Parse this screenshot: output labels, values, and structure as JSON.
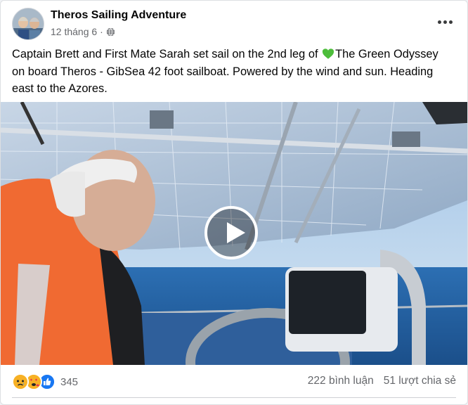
{
  "post": {
    "page_name": "Theros Sailing Adventure",
    "date": "12 tháng 6",
    "separator": "·",
    "text_before_emoji": "Captain Brett and First Mate Sarah set sail on the 2nd leg of ",
    "emoji": "green-heart",
    "text_after_emoji": "The Green Odyssey on board Theros - GibSea 42 foot sailboat. Powered by the wind and sun. Heading east to the Azores."
  },
  "reactions": {
    "icons": [
      "sad-icon",
      "love-face-icon",
      "like-icon"
    ],
    "count": "345"
  },
  "stats": {
    "comments": "222 bình luận",
    "shares": "51 lượt chia sẻ"
  },
  "colors": {
    "name": "#050505",
    "meta": "#65676b",
    "like_blue": "#1877f2",
    "reaction_yellow": "#f7b125",
    "heart_green": "#4dbd3b"
  }
}
